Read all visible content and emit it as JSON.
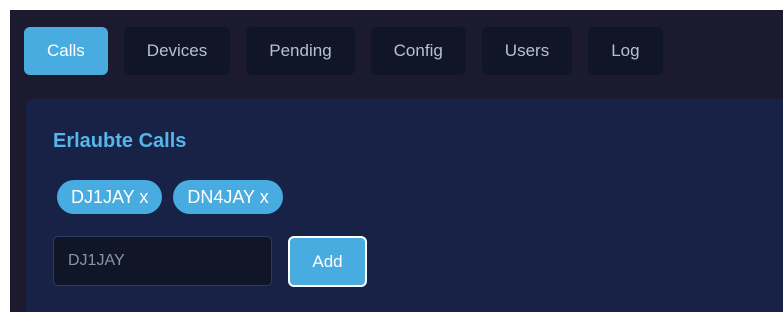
{
  "tabs": [
    {
      "label": "Calls",
      "active": true
    },
    {
      "label": "Devices",
      "active": false
    },
    {
      "label": "Pending",
      "active": false
    },
    {
      "label": "Config",
      "active": false
    },
    {
      "label": "Users",
      "active": false
    },
    {
      "label": "Log",
      "active": false
    }
  ],
  "panel": {
    "title": "Erlaubte Calls",
    "chips": [
      {
        "label": "DJ1JAY x"
      },
      {
        "label": "DN4JAY x"
      }
    ],
    "input": {
      "value": "",
      "placeholder": "DJ1JAY"
    },
    "add_label": "Add"
  },
  "colors": {
    "accent": "#48ace0",
    "background": "#1b1a2e",
    "panel": "#182246",
    "title": "#55b6ea"
  }
}
